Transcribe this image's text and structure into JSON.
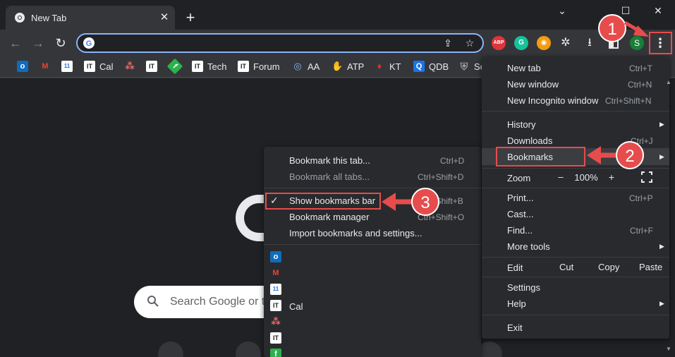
{
  "tab": {
    "title": "New Tab",
    "close": "✕",
    "new_tab": "+"
  },
  "window": {
    "minimize": "⌄",
    "maximize": "☐",
    "close": "✕"
  },
  "toolbar": {
    "back": "←",
    "forward": "→",
    "reload": "↻",
    "share": "⇪",
    "star": "☆",
    "download": "⭳",
    "extensions": "✲",
    "profile": "S",
    "menu": "⋮"
  },
  "extensions": [
    {
      "name": "ABP",
      "color": "#e0353d"
    },
    {
      "name": "G",
      "color": "#15c39a"
    },
    {
      "name": "◉",
      "color": "#f39c12"
    }
  ],
  "bookmarks_bar": [
    {
      "icon": "outlook-icon",
      "label": "",
      "color": "#0f6cbd",
      "glyph": "o"
    },
    {
      "icon": "gmail-icon",
      "label": "",
      "color": "#ea4335",
      "glyph": "M"
    },
    {
      "icon": "calendar-icon",
      "label": "",
      "color": "#1a73e8",
      "glyph": "11"
    },
    {
      "icon": "itechtics-icon",
      "label": "Cal",
      "color": "#ffffff",
      "glyph": "IT"
    },
    {
      "icon": "asana-icon",
      "label": "",
      "color": "#f06a6a",
      "glyph": "⁂"
    },
    {
      "icon": "itechtics-icon",
      "label": "",
      "color": "#ffffff",
      "glyph": "IT"
    },
    {
      "icon": "feedly-icon",
      "label": "",
      "color": "#2bb24c",
      "glyph": "f"
    },
    {
      "icon": "itechtics-icon",
      "label": "Tech",
      "color": "#ffffff",
      "glyph": "IT"
    },
    {
      "icon": "itechtics-icon",
      "label": "Forum",
      "color": "#ffffff",
      "glyph": "IT"
    },
    {
      "icon": "aa-icon",
      "label": "AA",
      "color": "#5b7bd5",
      "glyph": "◎"
    },
    {
      "icon": "atp-icon",
      "label": "ATP",
      "color": "#4b3fbf",
      "glyph": "✋"
    },
    {
      "icon": "kt-icon",
      "label": "KT",
      "color": "#d93025",
      "glyph": "♦"
    },
    {
      "icon": "qdb-icon",
      "label": "QDB",
      "color": "#1a73e8",
      "glyph": "Q"
    },
    {
      "icon": "shield-icon",
      "label": "Se",
      "color": "#9aa0a6",
      "glyph": "⛨"
    }
  ],
  "search": {
    "placeholder": "Search Google or t"
  },
  "main_menu": {
    "new_tab": {
      "label": "New tab",
      "shortcut": "Ctrl+T"
    },
    "new_window": {
      "label": "New window",
      "shortcut": "Ctrl+N"
    },
    "incognito": {
      "label": "New Incognito window",
      "shortcut": "Ctrl+Shift+N"
    },
    "history": {
      "label": "History"
    },
    "downloads": {
      "label": "Downloads",
      "shortcut": "Ctrl+J"
    },
    "bookmarks": {
      "label": "Bookmarks"
    },
    "zoom": {
      "label": "Zoom",
      "minus": "–",
      "value": "100%",
      "plus": "+",
      "fullscreen": "⛶"
    },
    "print": {
      "label": "Print...",
      "shortcut": "Ctrl+P"
    },
    "cast": {
      "label": "Cast..."
    },
    "find": {
      "label": "Find...",
      "shortcut": "Ctrl+F"
    },
    "more_tools": {
      "label": "More tools"
    },
    "edit": {
      "label": "Edit",
      "cut": "Cut",
      "copy": "Copy",
      "paste": "Paste"
    },
    "settings": {
      "label": "Settings"
    },
    "help": {
      "label": "Help"
    },
    "exit": {
      "label": "Exit"
    }
  },
  "bookmarks_menu": {
    "bookmark_tab": {
      "label": "Bookmark this tab...",
      "shortcut": "Ctrl+D"
    },
    "bookmark_all": {
      "label": "Bookmark all tabs...",
      "shortcut": "Ctrl+Shift+D"
    },
    "show_bar": {
      "label": "Show bookmarks bar",
      "shortcut": "Ctrl+Shift+B",
      "checked": true
    },
    "manager": {
      "label": "Bookmark manager",
      "shortcut": "Ctrl+Shift+O"
    },
    "import": {
      "label": "Import bookmarks and settings..."
    },
    "items": [
      {
        "icon": "outlook-icon",
        "label": "",
        "color": "#0f6cbd",
        "glyph": "o"
      },
      {
        "icon": "gmail-icon",
        "label": "",
        "color": "#ea4335",
        "glyph": "M"
      },
      {
        "icon": "calendar-icon",
        "label": "",
        "color": "#1a73e8",
        "glyph": "11"
      },
      {
        "icon": "itechtics-icon",
        "label": "Cal",
        "color": "#ffffff",
        "glyph": "IT"
      },
      {
        "icon": "asana-icon",
        "label": "",
        "color": "#f06a6a",
        "glyph": "⁂"
      },
      {
        "icon": "itechtics-icon",
        "label": "",
        "color": "#ffffff",
        "glyph": "IT"
      },
      {
        "icon": "feedly-icon",
        "label": "",
        "color": "#2bb24c",
        "glyph": "f"
      }
    ]
  },
  "annotations": {
    "step1": "1",
    "step2": "2",
    "step3": "3",
    "color": "#e74c4c"
  },
  "scrollbar": {
    "up": "▲",
    "down": "▼"
  }
}
